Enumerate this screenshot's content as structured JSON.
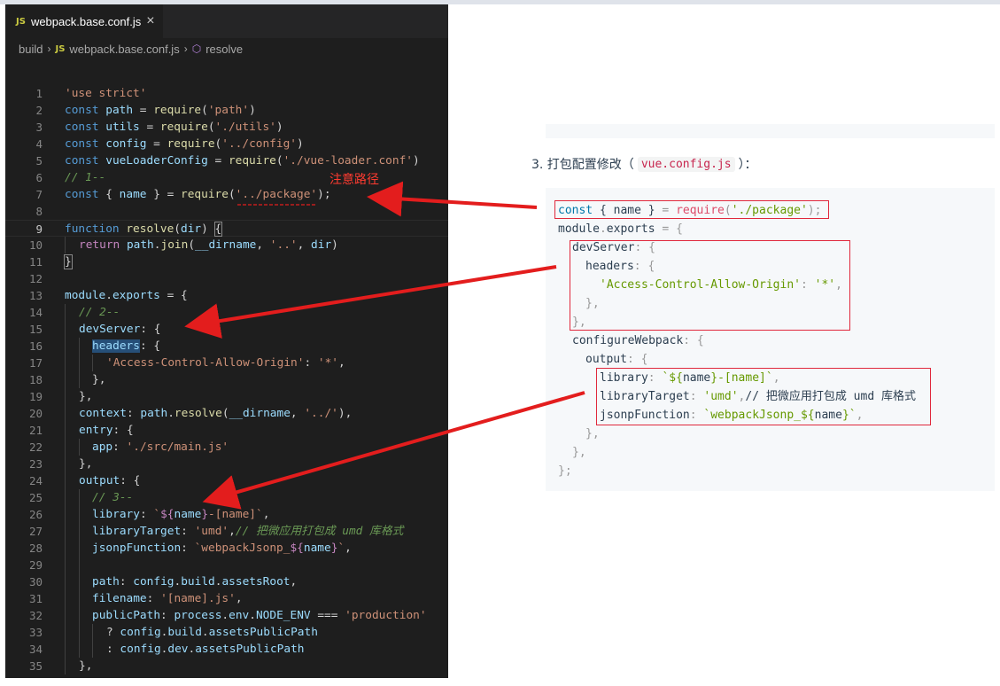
{
  "editor": {
    "tab": {
      "icon": "JS",
      "label": "webpack.base.conf.js",
      "close": "×"
    },
    "breadcrumb": {
      "folder": "build",
      "file_icon": "JS",
      "file": "webpack.base.conf.js",
      "symbol": "resolve"
    },
    "annotation": "注意路径",
    "lines": [
      {
        "n": "1"
      },
      {
        "n": "2"
      },
      {
        "n": "3"
      },
      {
        "n": "4"
      },
      {
        "n": "5"
      },
      {
        "n": "6"
      },
      {
        "n": "7"
      },
      {
        "n": "8"
      },
      {
        "n": "9"
      },
      {
        "n": "10"
      },
      {
        "n": "11"
      },
      {
        "n": "12"
      },
      {
        "n": "13"
      },
      {
        "n": "14"
      },
      {
        "n": "15"
      },
      {
        "n": "16"
      },
      {
        "n": "17"
      },
      {
        "n": "18"
      },
      {
        "n": "19"
      },
      {
        "n": "20"
      },
      {
        "n": "21"
      },
      {
        "n": "22"
      },
      {
        "n": "23"
      },
      {
        "n": "24"
      },
      {
        "n": "25"
      },
      {
        "n": "26"
      },
      {
        "n": "27"
      },
      {
        "n": "28"
      },
      {
        "n": "29"
      },
      {
        "n": "30"
      },
      {
        "n": "31"
      },
      {
        "n": "32"
      },
      {
        "n": "33"
      },
      {
        "n": "34"
      },
      {
        "n": "35"
      }
    ],
    "code": {
      "l1_str": "'use strict'",
      "l2_name": "path",
      "l2_arg": "'path'",
      "l3_name": "utils",
      "l3_arg": "'./utils'",
      "l4_name": "config",
      "l4_arg": "'../config'",
      "l5_name": "vueLoaderConfig",
      "l5_arg": "'./vue-loader.conf'",
      "l6_comment": "// 1--",
      "l7_name": "name",
      "l7_arg": "'../package'",
      "l9_fn": "resolve",
      "l9_param": "dir",
      "l10_ret_a": "path",
      "l10_ret_b": "join",
      "l10_a1": "__dirname",
      "l10_a2": "'..'",
      "l10_a3": "dir",
      "l13_a": "module",
      "l13_b": "exports",
      "l14_comment": "// 2--",
      "l15_key": "devServer",
      "l16_key": "headers",
      "l17_k": "'Access-Control-Allow-Origin'",
      "l17_v": "'*'",
      "l20_key": "context",
      "l20_a": "path",
      "l20_b": "resolve",
      "l20_c": "__dirname",
      "l20_d": "'../'",
      "l21_key": "entry",
      "l22_key": "app",
      "l22_val": "'./src/main.js'",
      "l24_key": "output",
      "l25_comment": "// 3--",
      "l26_key": "library",
      "l26_a": "`",
      "l26_b": "${",
      "l26_c": "name",
      "l26_d": "}",
      "l26_e": "-[name]`",
      "l27_key": "libraryTarget",
      "l27_val": "'umd'",
      "l27_comment": "// 把微应用打包成 umd 库格式",
      "l28_key": "jsonpFunction",
      "l28_a": "`webpackJsonp_",
      "l28_b": "${",
      "l28_c": "name",
      "l28_d": "}",
      "l28_e": "`",
      "l30_key": "path",
      "l30_a": "config",
      "l30_b": "build",
      "l30_c": "assetsRoot",
      "l31_key": "filename",
      "l31_val": "'[name].js'",
      "l32_key": "publicPath",
      "l32_a": "process",
      "l32_b": "env",
      "l32_c": "NODE_ENV",
      "l32_d": "'production'",
      "l33_a": "config",
      "l33_b": "build",
      "l33_c": "assetsPublicPath",
      "l34_a": "config",
      "l34_b": "dev",
      "l34_c": "assetsPublicPath"
    }
  },
  "doc": {
    "heading_prefix": "3. 打包配置修改（",
    "heading_code": "vue.config.js",
    "heading_suffix": "）：",
    "d1_a": "const",
    "d1_b": "{ name }",
    "d1_c": "require",
    "d1_d": "'./package'",
    "d2_a": "module",
    "d2_b": "exports",
    "d3_key": "devServer",
    "d4_key": "headers",
    "d5_k": "'Access-Control-Allow-Origin'",
    "d5_v": "'*'",
    "d8_key": "configureWebpack",
    "d9_key": "output",
    "d10_key": "library",
    "d10_a": "`${",
    "d10_b": "name",
    "d10_c": "}-[name]`",
    "d11_key": "libraryTarget",
    "d11_val": "'umd'",
    "d11_comment": "// 把微应用打包成 umd 库格式",
    "d12_key": "jsonpFunction",
    "d12_a": "`webpackJsonp_${",
    "d12_b": "name",
    "d12_c": "}`"
  },
  "colors": {
    "annotation": "#ff3b30",
    "box": "#e0283c",
    "editor_bg": "#1e1e1e"
  }
}
